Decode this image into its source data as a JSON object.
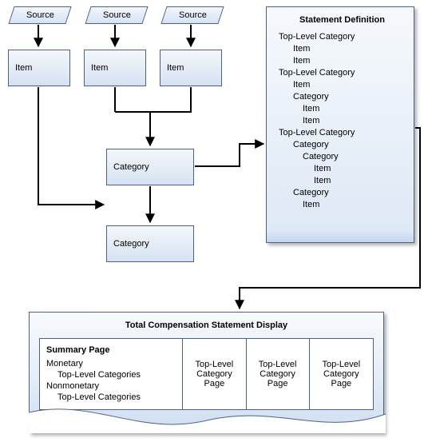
{
  "sources": [
    {
      "label": "Source"
    },
    {
      "label": "Source"
    },
    {
      "label": "Source"
    }
  ],
  "items": [
    {
      "label": "Item"
    },
    {
      "label": "Item"
    },
    {
      "label": "Item"
    }
  ],
  "categories": [
    {
      "label": "Category"
    },
    {
      "label": "Category"
    }
  ],
  "statement_definition": {
    "title": "Statement Definition",
    "lines": [
      {
        "text": "Top-Level Category",
        "indent": 0
      },
      {
        "text": "Item",
        "indent": 1
      },
      {
        "text": "Item",
        "indent": 1
      },
      {
        "text": "Top-Level Category",
        "indent": 0
      },
      {
        "text": "Item",
        "indent": 1
      },
      {
        "text": "Category",
        "indent": 1
      },
      {
        "text": "Item",
        "indent": 2
      },
      {
        "text": "Item",
        "indent": 2
      },
      {
        "text": "Top-Level Category",
        "indent": 0
      },
      {
        "text": "Category",
        "indent": 1
      },
      {
        "text": "Category",
        "indent": 2
      },
      {
        "text": "Item",
        "indent": 3
      },
      {
        "text": "Item",
        "indent": 3
      },
      {
        "text": "Category",
        "indent": 1
      },
      {
        "text": "Item",
        "indent": 2
      }
    ]
  },
  "display": {
    "title": "Total Compensation Statement Display",
    "summary": {
      "title": "Summary Page",
      "groups": [
        {
          "label": "Monetary",
          "sub": "Top-Level Categories"
        },
        {
          "label": "Nonmonetary",
          "sub": "Top-Level Categories"
        }
      ]
    },
    "pages": [
      {
        "label": "Top-Level Category Page"
      },
      {
        "label": "Top-Level Category Page"
      },
      {
        "label": "Top-Level Category Page"
      }
    ]
  }
}
